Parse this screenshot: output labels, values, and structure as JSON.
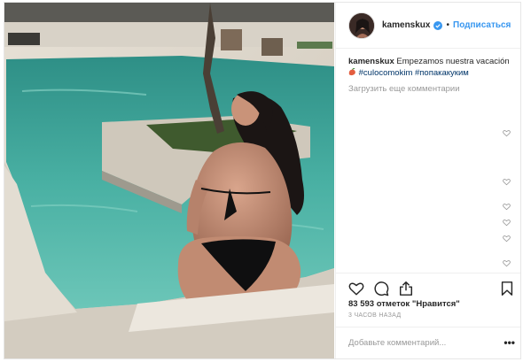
{
  "post": {
    "image_alt_subject": "woman-in-bikini-at-pool-photo",
    "author": {
      "username": "kamenskux",
      "verified": true,
      "follow_separator": "•",
      "follow_label": "Подписаться"
    },
    "caption": {
      "username": "kamenskux",
      "text": "Empezamos nuestra vacación",
      "emoji_icon": "peach-emoji-icon",
      "hashtags": [
        "#culocomokim",
        "#попакакуким"
      ]
    },
    "load_more_label": "Загрузить еще комментарии",
    "likes_text": "83 593 отметок \"Нравится\"",
    "timestamp": "3 ЧАСОВ НАЗАД",
    "add_comment_placeholder": "Добавьте комментарий...",
    "more_options_label": "•••"
  },
  "colors": {
    "link_blue": "#3897f0",
    "hashtag_blue": "#003569",
    "muted_gray": "#999999",
    "text": "#262626",
    "divider": "#efefef"
  },
  "icons": {
    "like": "heart-icon",
    "comment": "comment-bubble-icon",
    "share": "share-icon",
    "save": "bookmark-icon",
    "comment_like": "small-heart-icon"
  }
}
